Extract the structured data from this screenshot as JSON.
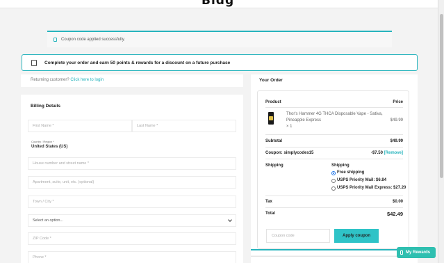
{
  "header": {
    "logo_text": "Bldg"
  },
  "notice": {
    "message": "Coupon code applied successfully."
  },
  "rewards_banner": {
    "text": "Complete your order and earn 50 points & rewards for a discount on a future purchase"
  },
  "returning": {
    "prefix": "Returning customer? ",
    "link": "Click here to login"
  },
  "billing": {
    "title": "Billing Details",
    "first_name": "First Name *",
    "last_name": "Last Name *",
    "country_label": "Country / Region *",
    "country_value": "United States (US)",
    "street": "House number and street name *",
    "apartment": "Apartment, suite, unit, etc. (optional)",
    "city": "Town / City *",
    "state_select": "Select an option...",
    "zip": "ZIP Code *",
    "phone": "Phone *"
  },
  "order": {
    "title": "Your Order",
    "col_product": "Product",
    "col_price": "Price",
    "item_name_line1": "Thor's Hammer 4G THCA Disposable Vape - Sativa,",
    "item_name_line2": "Pineapple Express",
    "item_qty": "× 1",
    "item_price": "$49.99",
    "subtotal_label": "Subtotal",
    "subtotal_value": "$49.99",
    "coupon_label": "Coupon: simplycodes15",
    "coupon_value": "-$7.50",
    "coupon_remove": "[Remove]",
    "shipping_label": "Shipping",
    "shipping_heading": "Shipping",
    "shipping_options": [
      "Free shipping",
      "USPS Priority Mail: $6.84",
      "USPS Priority Mail Express: $27.20"
    ],
    "shipping_selected": "Free shipping",
    "tax_label": "Tax",
    "tax_value": "$0.00",
    "total_label": "Total",
    "total_value": "$42.49",
    "coupon_placeholder": "Coupon code",
    "apply_label": "Apply coupon"
  },
  "rewards_widget": {
    "label": "My Rewards"
  },
  "colors": {
    "accent": "#27b4bd",
    "button": "#2fc3c7",
    "widget": "#2fbfb0"
  }
}
